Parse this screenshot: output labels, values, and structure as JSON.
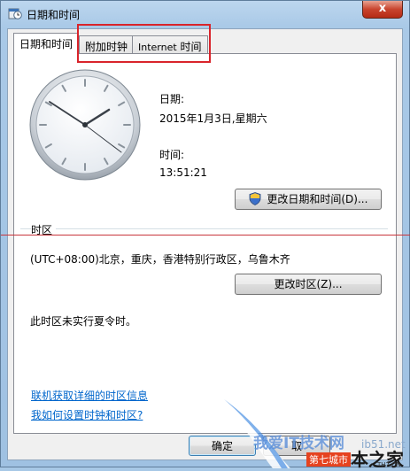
{
  "window": {
    "title": "日期和时间",
    "close_label": "x"
  },
  "tabs": [
    {
      "label": "日期和时间"
    },
    {
      "label": "附加时钟"
    },
    {
      "label_latin": "Internet",
      "label_cjk": "时间"
    }
  ],
  "datetime": {
    "date_label": "日期:",
    "date_value": "2015年1月3日,星期六",
    "time_label": "时间:",
    "time_value": "13:51:21",
    "change_datetime_button": "更改日期和时间(D)..."
  },
  "timezone": {
    "section_label": "时区",
    "value": "(UTC+08:00)北京，重庆，香港特别行政区，乌鲁木齐",
    "change_button": "更改时区(Z)...",
    "dst_note": "此时区未实行夏令时。"
  },
  "links": {
    "online_info": "联机获取详细的时区信息",
    "how_to_set": "我如何设置时钟和时区?"
  },
  "footer": {
    "ok_button": "确定",
    "cancel_button": "取"
  },
  "watermarks": {
    "site_text": "我爱IT技术网",
    "url_fragment": "ib51.net",
    "corner_badge": "第七城市",
    "corner_text": "本之家",
    "corner_sub": "TH7.CN"
  },
  "colors": {
    "link": "#0066cc",
    "highlight_box": "#d9242b",
    "close_button": "#c8442e"
  }
}
